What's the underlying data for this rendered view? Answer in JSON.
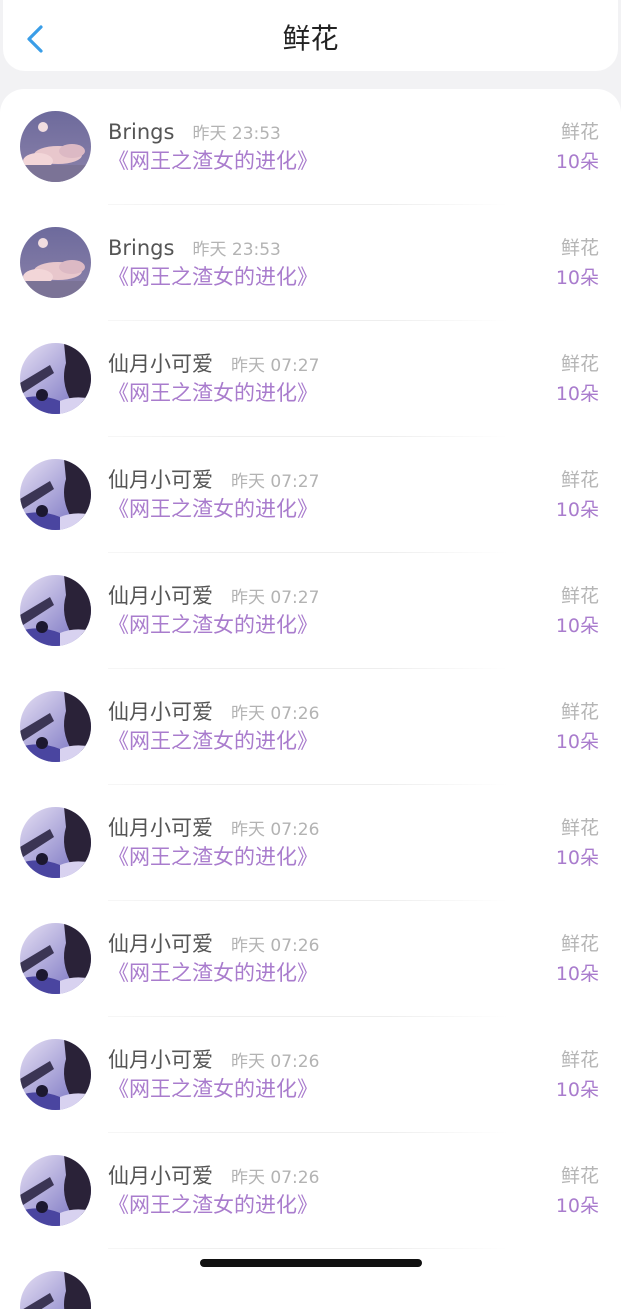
{
  "header": {
    "title": "鲜花",
    "back_icon": "chevron-left-icon",
    "accent_color": "#3a9ee8"
  },
  "colors": {
    "book_title": "#a97ccd",
    "gift_count": "#a97ccd",
    "muted": "#b5b5b5"
  },
  "rows": [
    {
      "user": "Brings",
      "time": "昨天 23:53",
      "book": "《网王之渣女的进化》",
      "gift": "鲜花",
      "count": "10朵",
      "avatar": "moon-clouds"
    },
    {
      "user": "Brings",
      "time": "昨天 23:53",
      "book": "《网王之渣女的进化》",
      "gift": "鲜花",
      "count": "10朵",
      "avatar": "moon-clouds"
    },
    {
      "user": "仙月小可爱",
      "time": "昨天 07:27",
      "book": "《网王之渣女的进化》",
      "gift": "鲜花",
      "count": "10朵",
      "avatar": "anime-girl"
    },
    {
      "user": "仙月小可爱",
      "time": "昨天 07:27",
      "book": "《网王之渣女的进化》",
      "gift": "鲜花",
      "count": "10朵",
      "avatar": "anime-girl"
    },
    {
      "user": "仙月小可爱",
      "time": "昨天 07:27",
      "book": "《网王之渣女的进化》",
      "gift": "鲜花",
      "count": "10朵",
      "avatar": "anime-girl"
    },
    {
      "user": "仙月小可爱",
      "time": "昨天 07:26",
      "book": "《网王之渣女的进化》",
      "gift": "鲜花",
      "count": "10朵",
      "avatar": "anime-girl"
    },
    {
      "user": "仙月小可爱",
      "time": "昨天 07:26",
      "book": "《网王之渣女的进化》",
      "gift": "鲜花",
      "count": "10朵",
      "avatar": "anime-girl"
    },
    {
      "user": "仙月小可爱",
      "time": "昨天 07:26",
      "book": "《网王之渣女的进化》",
      "gift": "鲜花",
      "count": "10朵",
      "avatar": "anime-girl"
    },
    {
      "user": "仙月小可爱",
      "time": "昨天 07:26",
      "book": "《网王之渣女的进化》",
      "gift": "鲜花",
      "count": "10朵",
      "avatar": "anime-girl"
    },
    {
      "user": "仙月小可爱",
      "time": "昨天 07:26",
      "book": "《网王之渣女的进化》",
      "gift": "鲜花",
      "count": "10朵",
      "avatar": "anime-girl"
    }
  ]
}
